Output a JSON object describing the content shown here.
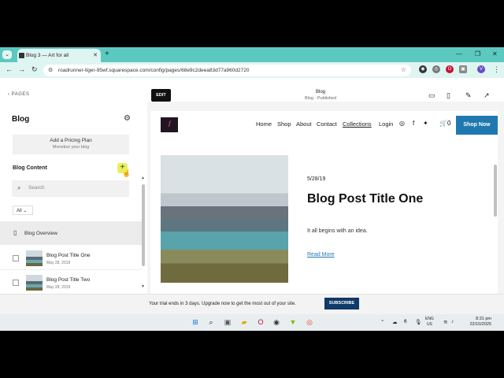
{
  "browser": {
    "tab_title": "Blog 3 — Art for all",
    "url": "roadrunner-tiger-95wf.squarespace.com/config/pages/68e9c2deea83d77a960d2720",
    "profile_initial": "V"
  },
  "sidebar": {
    "back_label": "PAGES",
    "title": "Blog",
    "pricing_title": "Add a Pricing Plan",
    "pricing_subtitle": "Monetize your blog",
    "content_heading": "Blog Content",
    "search_placeholder": "Search",
    "filter_label": "All",
    "overview_label": "Blog Overview",
    "posts": [
      {
        "title": "Blog Post Title One",
        "date": "May 28, 2019"
      },
      {
        "title": "Blog Post Title Two",
        "date": "May 28, 2019"
      }
    ]
  },
  "editor": {
    "edit_label": "EDIT",
    "page_name": "Blog",
    "page_status": "Blog · Published"
  },
  "site": {
    "nav": [
      "Home",
      "Shop",
      "About",
      "Contact",
      "Collections",
      "Login"
    ],
    "cart_count": "0",
    "shop_now": "Shop Now",
    "post": {
      "date": "5/28/19",
      "title": "Blog Post Title One",
      "excerpt": "It all begins with an idea.",
      "read_more": "Read More"
    }
  },
  "trial": {
    "message": "Your trial ends in 3 days. Upgrade now to get the most out of your site.",
    "subscribe": "SUBSCRIBE"
  },
  "taskbar": {
    "lang_line1": "ENG",
    "lang_line2": "US",
    "time": "8:31 pm",
    "date": "22/10/2025"
  },
  "colors": {
    "tab_bar": "#5cc9c0",
    "shop_now": "#1f79b0",
    "subscribe": "#103a68",
    "add_highlight": "#e8ef5a"
  }
}
